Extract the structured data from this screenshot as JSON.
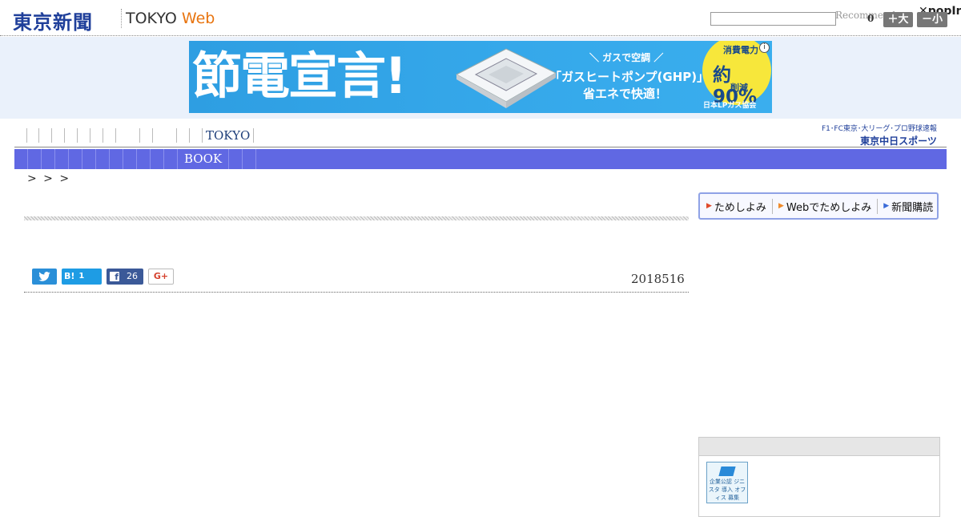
{
  "header": {
    "logo_main": "東京新聞",
    "logo_tokyo": "TOKYO ",
    "logo_web": "Web",
    "recommend_text": "Recommend",
    "popin_logo": "✕popIn",
    "share_count": "0",
    "font_large_label": "＋大",
    "font_small_label": "－小"
  },
  "ad": {
    "headline": "節電宣言!",
    "subline": "＼ ガスで空調 ／",
    "ghp_line": "「ガスヒートポンプ(GHP)」は",
    "save_line": "省エネで快適！",
    "circle_top": "消費電力",
    "circle_pct": "約90%",
    "circle_bottom": "削減",
    "org": "日本LPガス協会",
    "info_icon": "i"
  },
  "subnav": {
    "items": [
      "",
      "",
      "",
      "",
      "",
      "",
      "",
      "",
      "",
      "",
      "",
      "",
      "",
      "TOKYO",
      ""
    ]
  },
  "chunichi_sports": {
    "top_line": "F1･FC東京･大リーグ･プロ野球速報",
    "bottom_line": "東京中日スポーツ"
  },
  "mainnav": {
    "items": [
      "",
      "",
      "",
      "",
      "",
      "",
      "",
      "",
      "",
      "",
      "",
      "BOOK",
      "",
      ""
    ]
  },
  "breadcrumb": {
    "text": ">   > >"
  },
  "article": {
    "pub_date": "2018516"
  },
  "share": {
    "twitter_icon": "twitter-icon",
    "hatena_label": "B!",
    "hatena_count": "1",
    "facebook_label": "f",
    "facebook_count": "26",
    "gplus_label": "G+"
  },
  "sidebar": {
    "tameshi": [
      "ためしよみ",
      "Webでためしよみ",
      "新聞購読"
    ],
    "side_logo_text": "企業公認 ジニスタ 導入 オフィス 募集"
  }
}
